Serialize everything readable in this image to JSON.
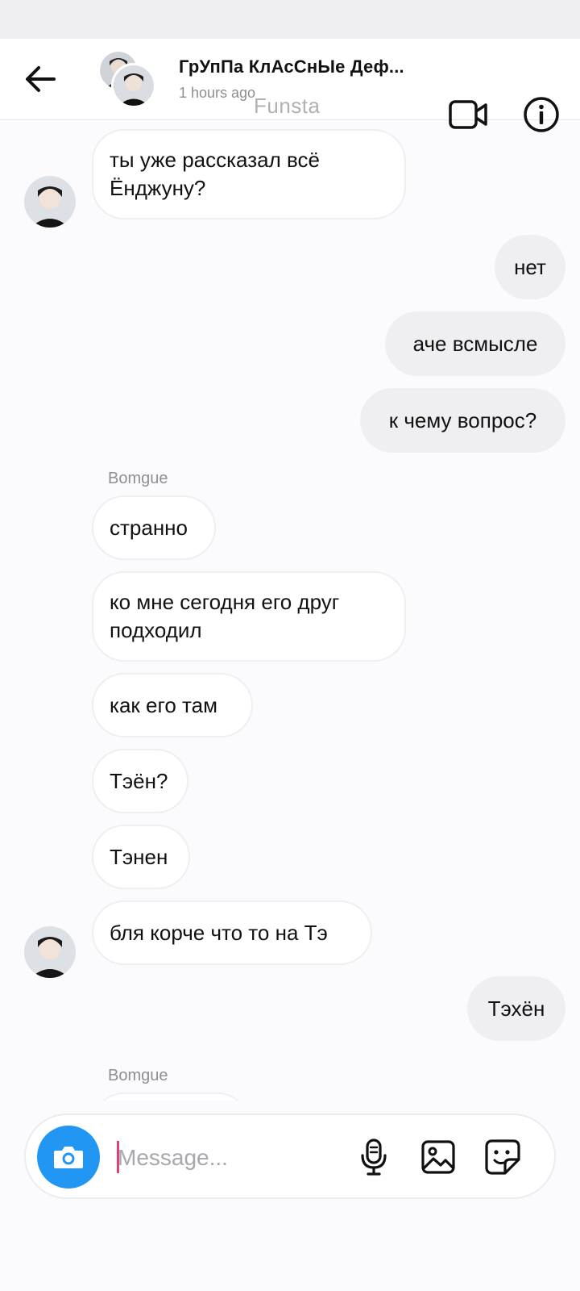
{
  "header": {
    "title": "ГрУпПа КлАсСнЫе Деф...",
    "status": "1 hours ago",
    "watermark": "Funsta"
  },
  "messages": [
    {
      "side": "in",
      "text": "ты уже рассказал всё Ёнджуну?",
      "avatar": true
    },
    {
      "side": "out",
      "text": "нет"
    },
    {
      "side": "out",
      "text": "аче всмысле"
    },
    {
      "side": "out",
      "text": "к чему вопрос?"
    },
    {
      "type": "sender",
      "text": "Bomgue"
    },
    {
      "side": "in",
      "text": "странно"
    },
    {
      "side": "in",
      "text": "ко мне сегодня его друг подходил"
    },
    {
      "side": "in",
      "text": "как его там"
    },
    {
      "side": "in",
      "text": "Тэён?"
    },
    {
      "side": "in",
      "text": "Тэнен"
    },
    {
      "side": "in",
      "text": "бля корче что то на Тэ",
      "avatar": true
    },
    {
      "side": "out",
      "text": "Тэхён"
    },
    {
      "type": "sender",
      "text": "Bomgue"
    }
  ],
  "composer": {
    "placeholder": "Message...",
    "value": ""
  },
  "colors": {
    "accent": "#2196f3",
    "cursor": "#e0407a",
    "incoming_bg": "#ffffff",
    "outgoing_bg": "#efeef1"
  },
  "icons": {
    "back": "arrow-left-icon",
    "video": "video-camera-icon",
    "info": "info-icon",
    "camera": "camera-icon",
    "mic": "microphone-icon",
    "gallery": "image-icon",
    "sticker": "sticker-icon"
  }
}
